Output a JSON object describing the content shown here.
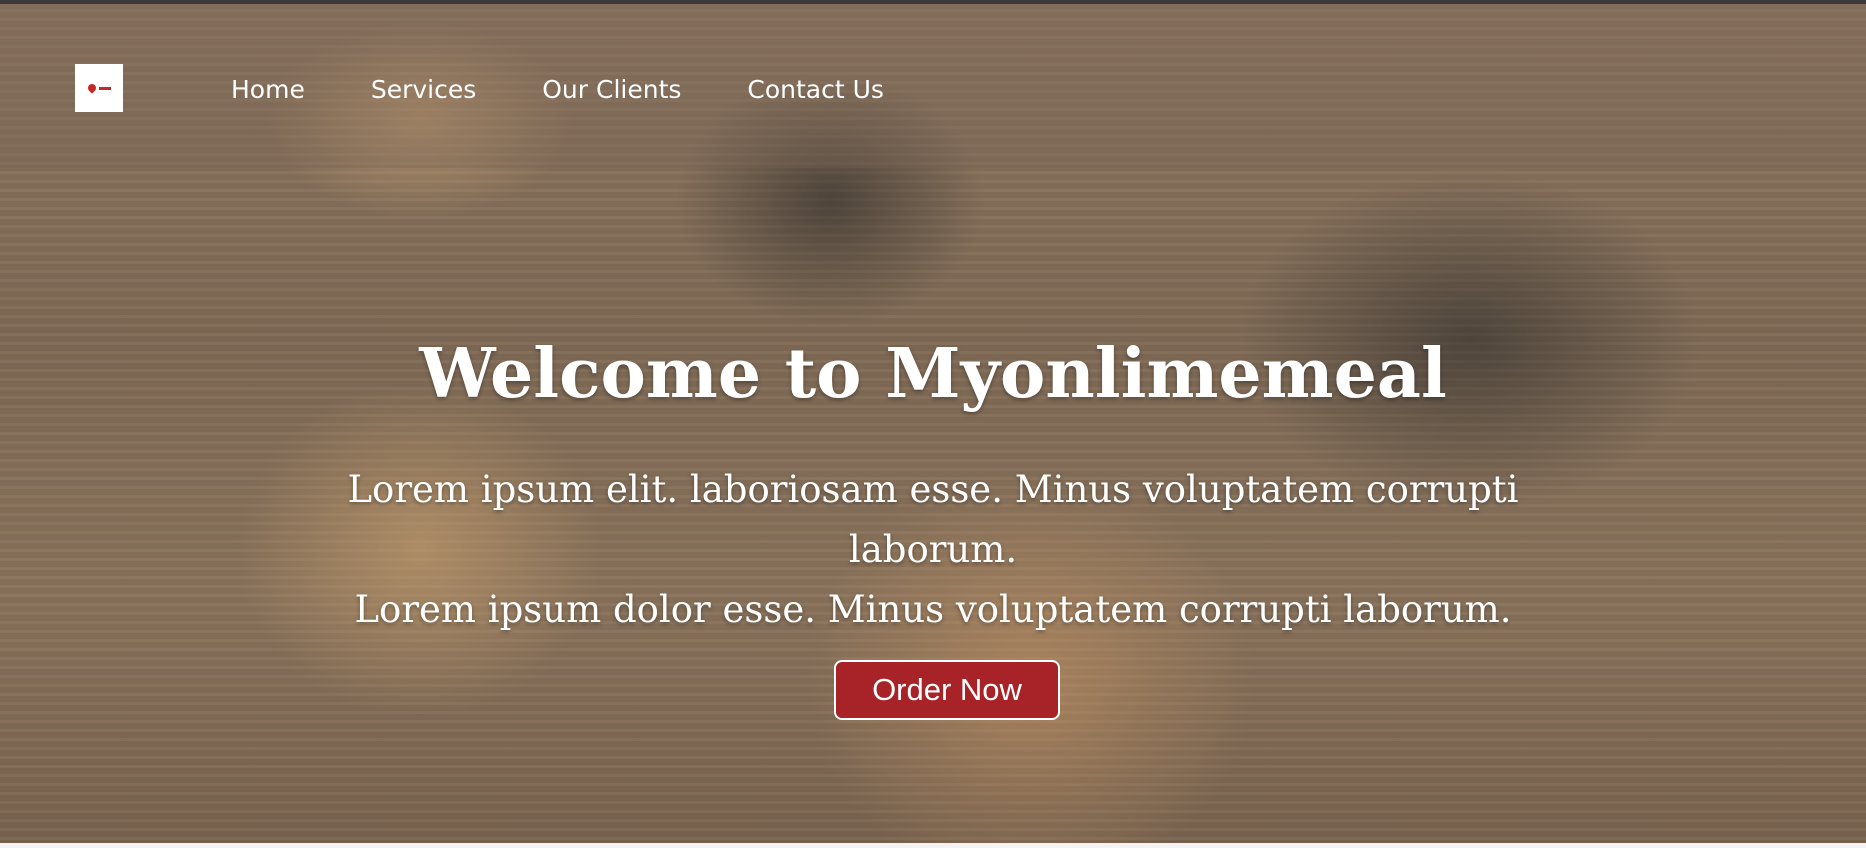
{
  "nav": {
    "items": [
      {
        "label": "Home"
      },
      {
        "label": "Services"
      },
      {
        "label": "Our Clients"
      },
      {
        "label": "Contact Us"
      }
    ]
  },
  "hero": {
    "title": "Welcome to Myonlimemeal",
    "line1": "Lorem ipsum elit. laboriosam esse. Minus voluptatem corrupti laborum.",
    "line2": "Lorem ipsum dolor esse. Minus voluptatem corrupti laborum.",
    "cta_label": "Order Now"
  },
  "colors": {
    "accent": "#a82327",
    "text": "#ffffff"
  },
  "icons": {
    "logo": "location-pin-logo"
  }
}
